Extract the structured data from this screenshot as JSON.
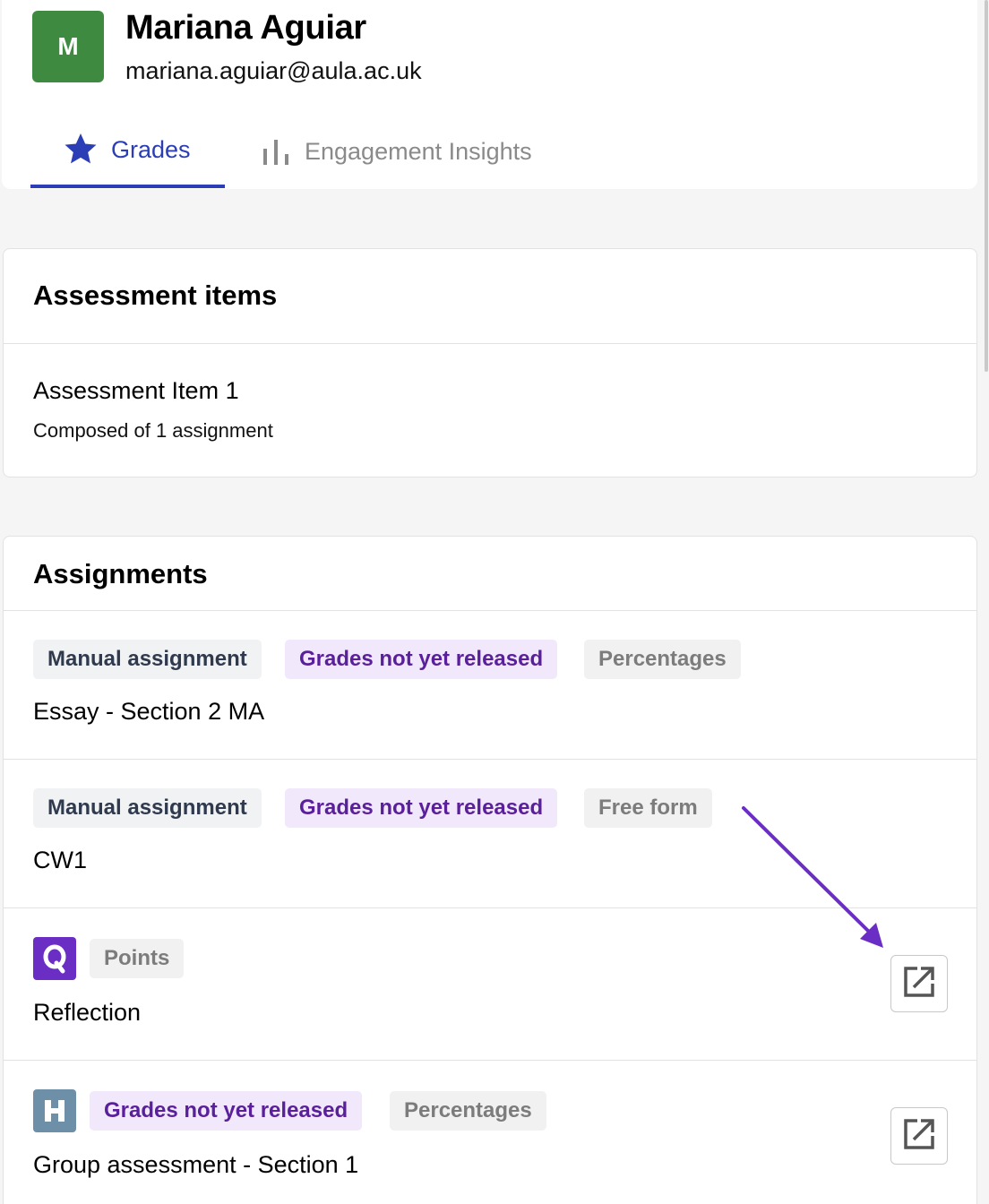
{
  "user": {
    "initial": "M",
    "name": "Mariana Aguiar",
    "email": "mariana.aguiar@aula.ac.uk",
    "avatar_color": "#3d8a40"
  },
  "tabs": [
    {
      "label": "Grades",
      "icon": "star-icon",
      "active": true
    },
    {
      "label": "Engagement Insights",
      "icon": "bar-chart-icon",
      "active": false
    }
  ],
  "assessment": {
    "heading": "Assessment items",
    "items": [
      {
        "title": "Assessment Item 1",
        "subtitle": "Composed of 1 assignment"
      }
    ]
  },
  "assignments": {
    "heading": "Assignments",
    "rows": [
      {
        "badges": [
          "Manual assignment",
          "Grades not yet released",
          "Percentages"
        ],
        "name": "Essay - Section 2 MA"
      },
      {
        "badges": [
          "Manual assignment",
          "Grades not yet released",
          "Free form"
        ],
        "name": "CW1"
      },
      {
        "app_icon": "q-app-icon",
        "badges": [
          "Points"
        ],
        "name": "Reflection"
      },
      {
        "app_icon": "h-app-icon",
        "badges": [
          "Grades not yet released",
          "Percentages"
        ],
        "name": "Group assessment - Section 1"
      }
    ]
  },
  "colors": {
    "accent": "#2b3eb5",
    "grades_badge_text": "#5a1f9a",
    "grades_badge_bg": "#f1e9fb",
    "annotation_arrow": "#6a2ec4"
  }
}
